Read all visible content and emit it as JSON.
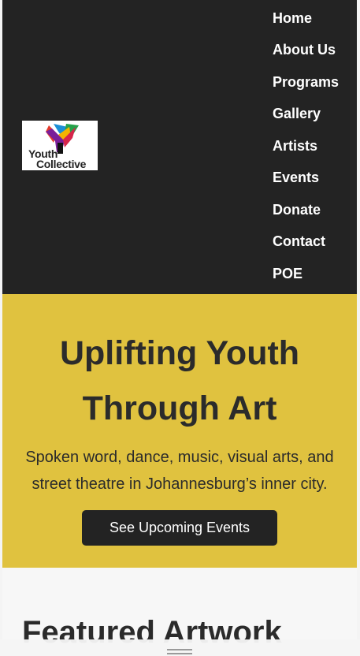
{
  "logo": {
    "line1": "Youth",
    "line2": "Collective"
  },
  "nav": {
    "items": [
      "Home",
      "About Us",
      "Programs",
      "Gallery",
      "Artists",
      "Events",
      "Donate",
      "Contact",
      "POE"
    ]
  },
  "hero": {
    "title": "Uplifting Youth Through Art",
    "subtitle": "Spoken word, dance, music, visual arts, and street theatre in Johannesburg’s inner city.",
    "cta_label": "See Upcoming Events"
  },
  "featured": {
    "title": "Featured Artwork"
  },
  "colors": {
    "header_bg": "#232323",
    "hero_bg": "#e0c23f",
    "text_dark": "#2b2b2b",
    "button_bg": "#232323"
  }
}
